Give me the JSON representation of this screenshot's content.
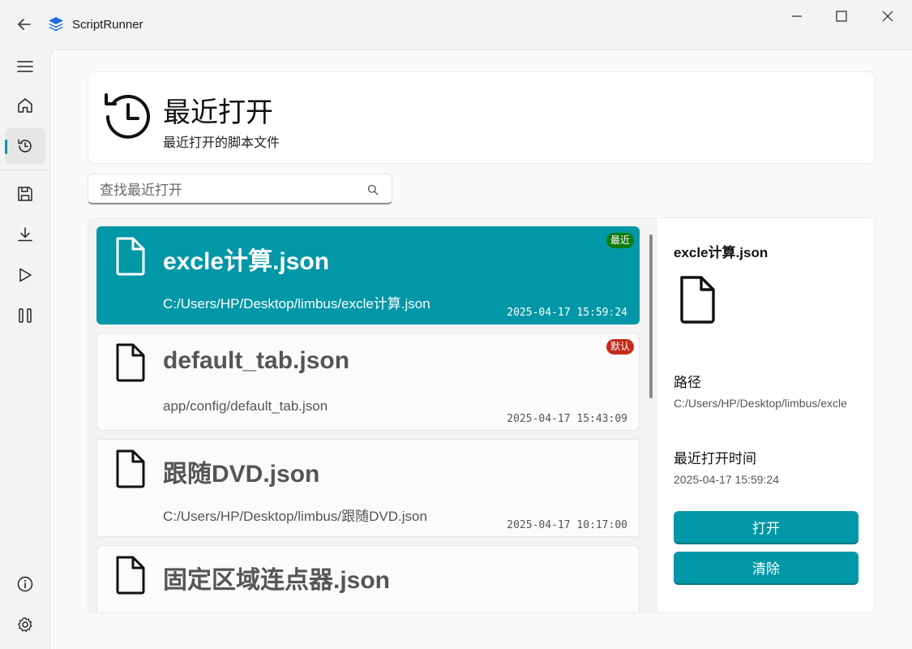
{
  "app": {
    "title": "ScriptRunner",
    "accent_color": "#0097a7"
  },
  "titlebar": {
    "icons": [
      "back-arrow-icon",
      "app-logo-icon",
      "minimize-icon",
      "maximize-icon",
      "close-icon"
    ]
  },
  "sidebar": {
    "items": [
      {
        "name": "menu",
        "icon": "hamburger-icon"
      },
      {
        "name": "home",
        "icon": "home-icon"
      },
      {
        "name": "recent",
        "icon": "history-icon",
        "active": true
      },
      {
        "name": "save",
        "icon": "save-icon"
      },
      {
        "name": "download",
        "icon": "download-icon"
      },
      {
        "name": "run",
        "icon": "play-icon"
      },
      {
        "name": "pause",
        "icon": "pause-icon"
      },
      {
        "name": "info",
        "icon": "info-icon"
      },
      {
        "name": "settings",
        "icon": "gear-icon"
      }
    ]
  },
  "header": {
    "title": "最近打开",
    "subtitle": "最近打开的脚本文件",
    "icon": "history-icon"
  },
  "search": {
    "placeholder": "查找最近打开",
    "value": ""
  },
  "files": [
    {
      "name": "excle计算.json",
      "path": "C:/Users/HP/Desktop/limbus/excle计算.json",
      "time": "2025-04-17 15:59:24",
      "badge": "最近",
      "badge_color": "#0f7b0f",
      "selected": true
    },
    {
      "name": "default_tab.json",
      "path": "app/config/default_tab.json",
      "time": "2025-04-17 15:43:09",
      "badge": "默认",
      "badge_color": "#c42b1c",
      "selected": false
    },
    {
      "name": "跟随DVD.json",
      "path": "C:/Users/HP/Desktop/limbus/跟随DVD.json",
      "time": "2025-04-17 10:17:00",
      "badge": "",
      "selected": false
    },
    {
      "name": "固定区域连点器.json",
      "path": "",
      "time": "",
      "badge": "",
      "selected": false
    }
  ],
  "detail": {
    "name": "excle计算.json",
    "path_label": "路径",
    "path_value": "C:/Users/HP/Desktop/limbus/excle",
    "time_label": "最近打开时间",
    "time_value": "2025-04-17 15:59:24",
    "open_label": "打开",
    "clear_label": "清除"
  }
}
